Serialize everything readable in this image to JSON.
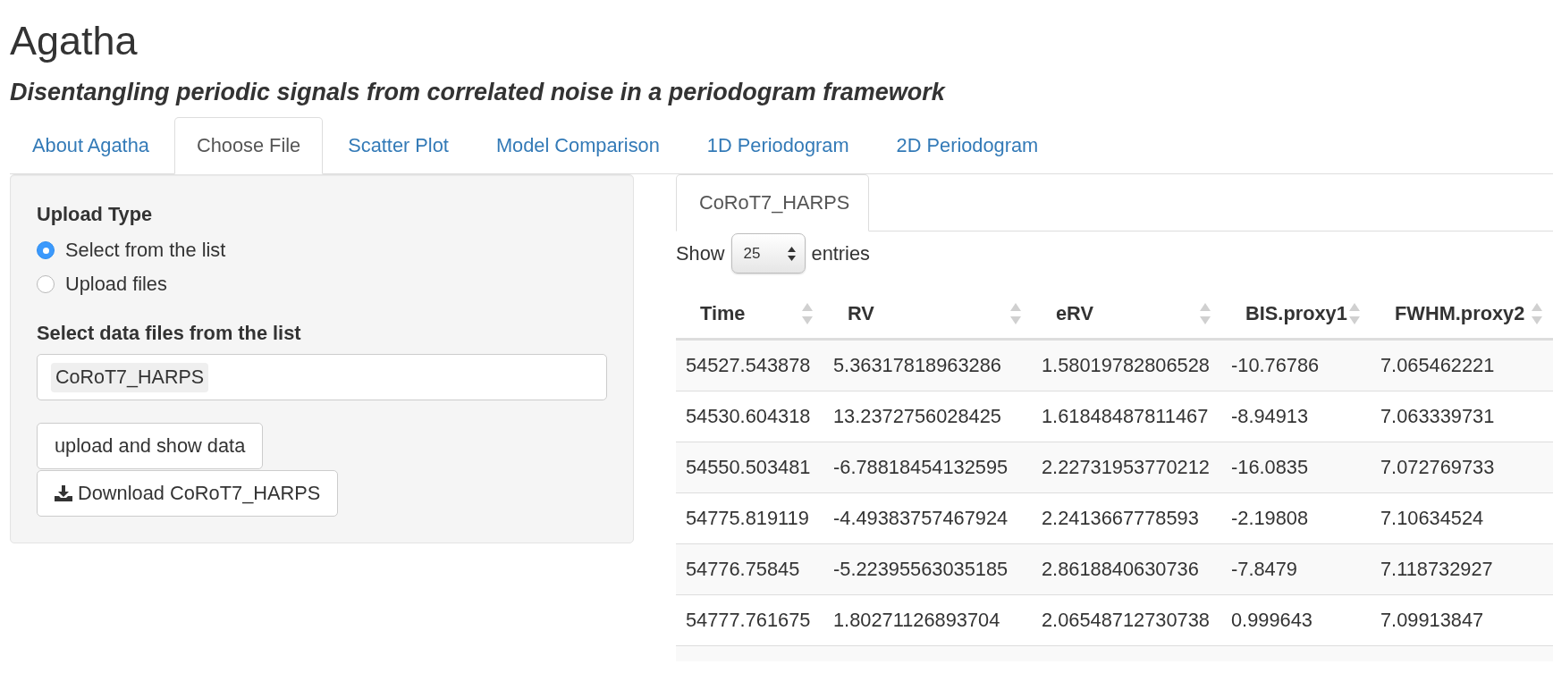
{
  "app": {
    "title": "Agatha",
    "subtitle": "Disentangling periodic signals from correlated noise in a periodogram framework"
  },
  "tabs": [
    {
      "label": "About Agatha",
      "selected": false
    },
    {
      "label": "Choose File",
      "selected": true
    },
    {
      "label": "Scatter Plot",
      "selected": false
    },
    {
      "label": "Model Comparison",
      "selected": false
    },
    {
      "label": "1D Periodogram",
      "selected": false
    },
    {
      "label": "2D Periodogram",
      "selected": false
    }
  ],
  "sidebar": {
    "upload_type": {
      "label": "Upload Type",
      "options": [
        {
          "label": "Select from the list",
          "selected": true
        },
        {
          "label": "Upload files",
          "selected": false
        }
      ]
    },
    "file_select": {
      "label": "Select data files from the list",
      "values": [
        "CoRoT7_HARPS"
      ]
    },
    "buttons": [
      {
        "label": "upload and show data",
        "kind": "plain"
      },
      {
        "label": "Download CoRoT7_HARPS",
        "kind": "download"
      }
    ]
  },
  "data_panel": {
    "tabs": [
      {
        "label": "CoRoT7_HARPS",
        "selected": true
      }
    ],
    "length_menu": {
      "prefix": "Show",
      "value": "25",
      "suffix": "entries"
    },
    "table": {
      "columns": [
        "Time",
        "RV",
        "eRV",
        "BIS.proxy1",
        "FWHM.proxy2"
      ],
      "rows": [
        [
          "54527.543878",
          "5.36317818963286",
          "1.58019782806528",
          "-10.76786",
          "7.065462221"
        ],
        [
          "54530.604318",
          "13.2372756028425",
          "1.61848487811467",
          "-8.94913",
          "7.063339731"
        ],
        [
          "54550.503481",
          "-6.78818454132595",
          "2.22731953770212",
          "-16.0835",
          "7.072769733"
        ],
        [
          "54775.819119",
          "-4.49383757467924",
          "2.2413667778593",
          "-2.19808",
          "7.10634524"
        ],
        [
          "54776.75845",
          "-5.22395563035185",
          "2.8618840630736",
          "-7.8479",
          "7.118732927"
        ],
        [
          "54777.761675",
          "1.80271126893704",
          "2.06548712730738",
          "0.999643",
          "7.09913847"
        ]
      ]
    }
  }
}
